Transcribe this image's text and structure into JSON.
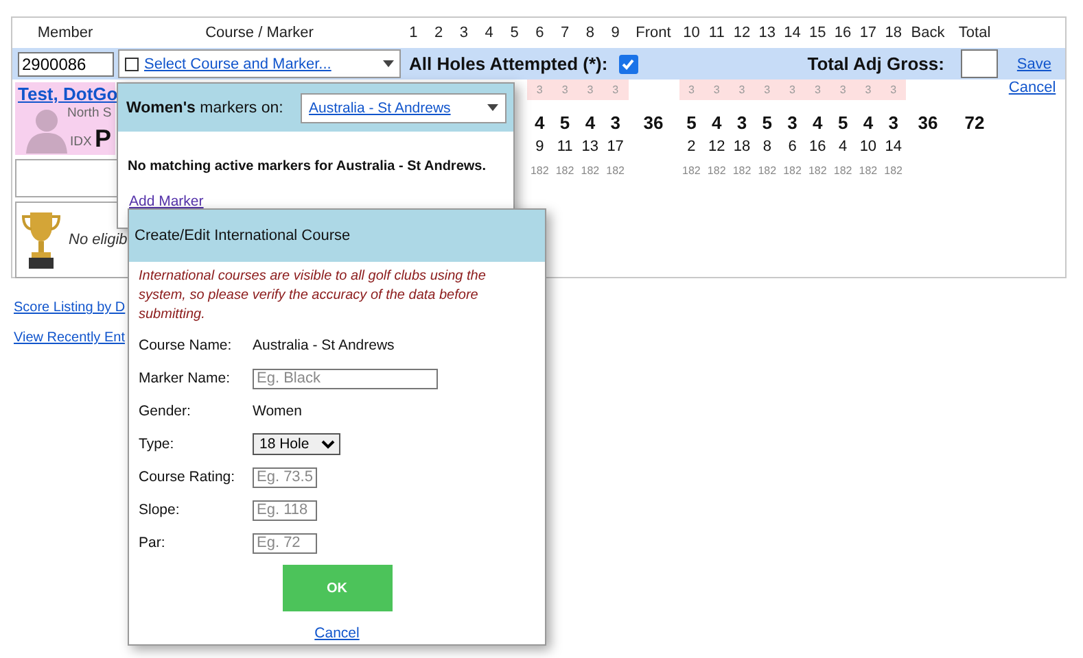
{
  "header": {
    "member": "Member",
    "course": "Course / Marker",
    "front_holes": [
      "1",
      "2",
      "3",
      "4",
      "5",
      "6",
      "7",
      "8",
      "9"
    ],
    "front": "Front",
    "back_holes": [
      "10",
      "11",
      "12",
      "13",
      "14",
      "15",
      "16",
      "17",
      "18"
    ],
    "back": "Back",
    "total": "Total"
  },
  "entry": {
    "member_id": "2900086",
    "course_checked": false,
    "course_link": "Select Course and Marker...",
    "all_holes_label": "All Holes Attempted (*):",
    "all_holes_checked": true,
    "total_label": "Total Adj Gross:",
    "save": "Save"
  },
  "cancel": "Cancel",
  "member": {
    "name": "Test, DotGo",
    "club": "North S",
    "idx_label": "IDX",
    "idx_value": "P"
  },
  "score_hints": {
    "front": [
      "3",
      "3",
      "3",
      "3"
    ],
    "back": [
      "3",
      "3",
      "3",
      "3",
      "3",
      "3",
      "3",
      "3",
      "3"
    ]
  },
  "par": {
    "front": [
      "4",
      "5",
      "4",
      "3"
    ],
    "front_total": "36",
    "back": [
      "5",
      "4",
      "3",
      "5",
      "3",
      "4",
      "5",
      "4",
      "3"
    ],
    "back_total": "36",
    "total": "72"
  },
  "stroke_index": {
    "front": [
      "9",
      "11",
      "13",
      "17"
    ],
    "back": [
      "2",
      "12",
      "18",
      "8",
      "6",
      "16",
      "4",
      "10",
      "14"
    ]
  },
  "yardage": {
    "front": [
      "182",
      "182",
      "182",
      "182"
    ],
    "back": [
      "182",
      "182",
      "182",
      "182",
      "182",
      "182",
      "182",
      "182",
      "182"
    ]
  },
  "trophy_note": "No eligib",
  "links": [
    "Score Listing by D",
    "View Recently Ent"
  ],
  "marker_popup": {
    "title": "**Women's** markers on:",
    "course": "Australia - St Andrews",
    "message": "No matching active markers for Australia - St Andrews.",
    "add_link": "Add Marker"
  },
  "dialog": {
    "title": "Create/Edit International Course",
    "note": "International courses are visible to all golf clubs using the system, so please verify the accuracy of the data before submitting.",
    "fields": [
      {
        "kind": "text",
        "label": "Course Name:",
        "value": "Australia - St Andrews"
      },
      {
        "kind": "wide_input",
        "label": "Marker Name:",
        "placeholder": "Eg. Black"
      },
      {
        "kind": "text",
        "label": "Gender:",
        "value": "Women"
      },
      {
        "kind": "select",
        "label": "Type:",
        "value": "18 Hole"
      },
      {
        "kind": "input",
        "label": "Course Rating:",
        "placeholder": "Eg. 73.5"
      },
      {
        "kind": "input",
        "label": "Slope:",
        "placeholder": "Eg. 118"
      },
      {
        "kind": "input",
        "label": "Par:",
        "placeholder": "Eg. 72"
      }
    ],
    "ok": "OK",
    "cancel": "Cancel"
  }
}
